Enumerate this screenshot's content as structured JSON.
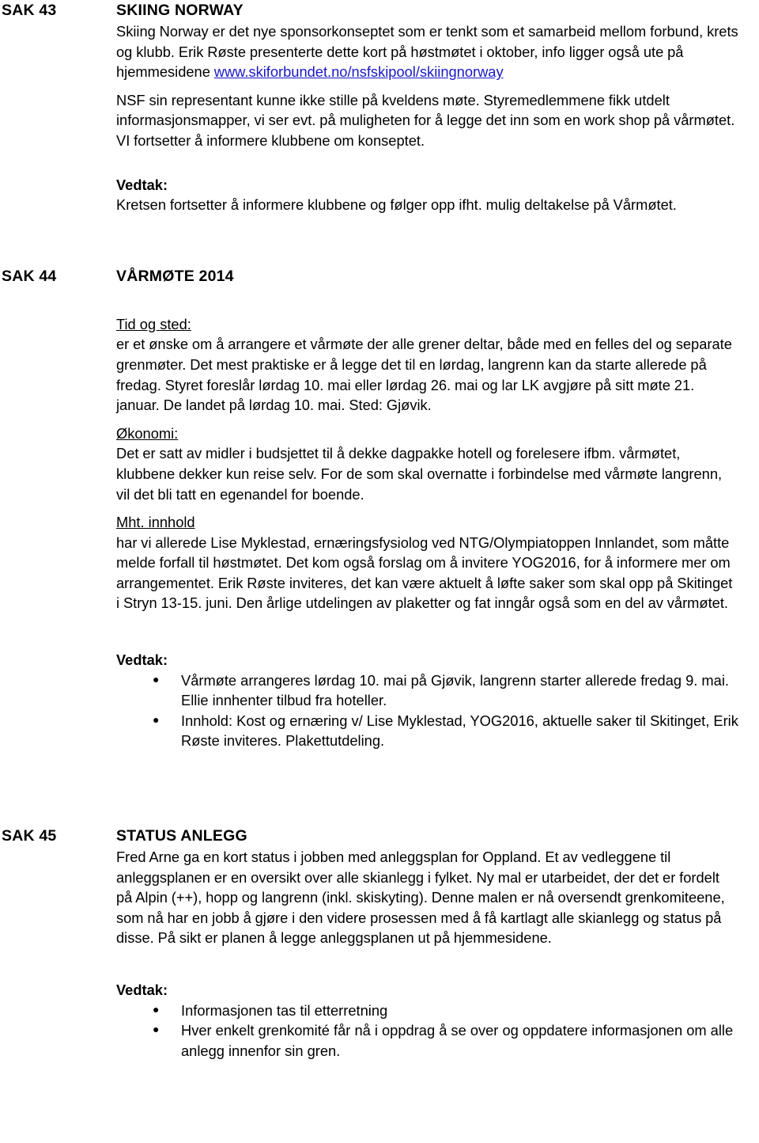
{
  "document": {
    "sections": [
      {
        "id": "sak-43",
        "label": "SAK 43",
        "title": "SKIING NORWAY",
        "paragraph_1_before_link": "Skiing Norway er det nye sponsorkonseptet som er tenkt som et samarbeid mellom forbund, krets og klubb. Erik Røste presenterte dette kort på høstmøtet i oktober, info ligger også ute på hjemmesidene ",
        "link_text": "www.skiforbundet.no/nsfskipool/skiingnorway",
        "paragraph_2": "NSF sin representant kunne ikke stille på kveldens møte. Styremedlemmene fikk utdelt informasjonsmapper, vi ser evt. på muligheten for å legge det inn som en work shop på vårmøtet. VI fortsetter å informere klubbene om konseptet.",
        "vedtak_label": "Vedtak:",
        "vedtak_text": "Kretsen fortsetter å informere klubbene og følger opp ifht. mulig deltakelse på Vårmøtet."
      },
      {
        "id": "sak-44",
        "label": "SAK 44",
        "title": "VÅRMØTE 2014",
        "heading_tid_og_sted": "Tid og sted:",
        "tid_og_sted_text": "er et ønske om å arrangere et vårmøte der alle grener deltar, både med en felles del og separate grenmøter. Det mest praktiske er å legge det til en lørdag, langrenn kan da starte allerede på fredag. Styret foreslår lørdag 10. mai eller lørdag 26. mai og lar LK avgjøre på sitt møte 21. januar. De landet på lørdag 10. mai. Sted: Gjøvik.",
        "heading_okonomi": "Økonomi:",
        "okonomi_text": "Det er satt av midler i budsjettet til å dekke dagpakke hotell og forelesere ifbm. vårmøtet, klubbene dekker kun reise selv. For de som skal overnatte i forbindelse med vårmøte langrenn, vil det bli tatt en egenandel for boende.",
        "heading_mht_innhold": "Mht. innhold",
        "mht_innhold_text": "har vi allerede Lise Myklestad, ernæringsfysiolog ved NTG/Olympiatoppen Innlandet, som måtte melde forfall til høstmøtet. Det kom også forslag om å invitere YOG2016, for å informere mer om arrangementet. Erik Røste inviteres, det kan være aktuelt å løfte saker som skal opp på Skitinget i Stryn 13-15. juni. Den årlige utdelingen av plaketter og fat inngår også som en del av vårmøtet.",
        "vedtak_label": "Vedtak:",
        "vedtak_bullets": [
          "Vårmøte arrangeres lørdag 10. mai på Gjøvik, langrenn starter allerede fredag 9. mai. Ellie innhenter tilbud fra hoteller.",
          "Innhold: Kost og ernæring v/ Lise Myklestad, YOG2016, aktuelle saker til Skitinget, Erik Røste inviteres. Plakettutdeling."
        ]
      },
      {
        "id": "sak-45",
        "label": "SAK 45",
        "title": "STATUS ANLEGG",
        "paragraph_1": "Fred Arne ga en kort status i jobben med anleggsplan for Oppland. Et av vedleggene til anleggsplanen er en oversikt over alle skianlegg i fylket. Ny mal er utarbeidet, der det er fordelt på Alpin (++), hopp og langrenn (inkl. skiskyting). Denne malen er nå oversendt grenkomiteene, som nå har en jobb å gjøre i den videre prosessen med å få kartlagt alle skianlegg og status på disse.  På sikt er planen å legge anleggsplanen ut på hjemmesidene.",
        "vedtak_label": "Vedtak:",
        "vedtak_bullets": [
          "Informasjonen tas til etterretning",
          "Hver enkelt grenkomité får nå i oppdrag å se over og oppdatere informasjonen om alle anlegg innenfor sin gren."
        ]
      }
    ],
    "bullet_glyph": "●",
    "link_color": "#1818C8"
  }
}
